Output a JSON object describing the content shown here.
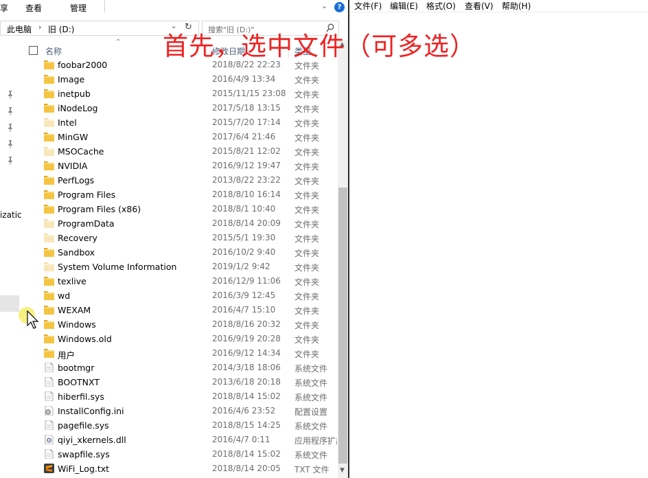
{
  "explorer": {
    "ribbon": {
      "tabs": [
        "享",
        "查看",
        "管理"
      ]
    },
    "address": {
      "crumbs": [
        "此电脑",
        "旧 (D:)"
      ]
    },
    "search": {
      "placeholder": "搜索\"旧 (D:)\""
    },
    "nav": {
      "partial_text": "izatic"
    },
    "columns": {
      "name": "名称",
      "date": "修改日期",
      "type": "类型"
    },
    "files": [
      {
        "name": "foobar2000",
        "date": "2018/8/22 22:23",
        "type": "文件夹",
        "icon": "folder-icon"
      },
      {
        "name": "Image",
        "date": "2016/4/9 13:34",
        "type": "文件夹",
        "icon": "folder-icon"
      },
      {
        "name": "inetpub",
        "date": "2015/11/15 23:08",
        "type": "文件夹",
        "icon": "folder-icon"
      },
      {
        "name": "iNodeLog",
        "date": "2017/5/18 13:15",
        "type": "文件夹",
        "icon": "folder-icon"
      },
      {
        "name": "Intel",
        "date": "2015/7/20 17:14",
        "type": "文件夹",
        "icon": "folder-hidden-icon"
      },
      {
        "name": "MinGW",
        "date": "2017/6/4 21:46",
        "type": "文件夹",
        "icon": "folder-icon"
      },
      {
        "name": "MSOCache",
        "date": "2015/8/21 12:02",
        "type": "文件夹",
        "icon": "folder-hidden-icon"
      },
      {
        "name": "NVIDIA",
        "date": "2016/9/12 19:47",
        "type": "文件夹",
        "icon": "folder-icon"
      },
      {
        "name": "PerfLogs",
        "date": "2013/8/22 23:22",
        "type": "文件夹",
        "icon": "folder-icon"
      },
      {
        "name": "Program Files",
        "date": "2018/8/10 16:14",
        "type": "文件夹",
        "icon": "folder-icon"
      },
      {
        "name": "Program Files (x86)",
        "date": "2018/8/1 10:40",
        "type": "文件夹",
        "icon": "folder-icon"
      },
      {
        "name": "ProgramData",
        "date": "2018/8/14 20:09",
        "type": "文件夹",
        "icon": "folder-hidden-icon"
      },
      {
        "name": "Recovery",
        "date": "2015/5/1 19:30",
        "type": "文件夹",
        "icon": "folder-hidden-icon"
      },
      {
        "name": "Sandbox",
        "date": "2016/10/2 9:40",
        "type": "文件夹",
        "icon": "folder-icon"
      },
      {
        "name": "System Volume Information",
        "date": "2019/1/2 9:42",
        "type": "文件夹",
        "icon": "folder-hidden-icon"
      },
      {
        "name": "texlive",
        "date": "2016/12/9 11:06",
        "type": "文件夹",
        "icon": "folder-icon"
      },
      {
        "name": "wd",
        "date": "2016/3/9 12:45",
        "type": "文件夹",
        "icon": "folder-icon"
      },
      {
        "name": "WEXAM",
        "date": "2016/4/7 15:10",
        "type": "文件夹",
        "icon": "folder-icon"
      },
      {
        "name": "Windows",
        "date": "2018/8/16 20:32",
        "type": "文件夹",
        "icon": "folder-icon"
      },
      {
        "name": "Windows.old",
        "date": "2016/9/19 20:28",
        "type": "文件夹",
        "icon": "folder-icon"
      },
      {
        "name": "用户",
        "date": "2016/9/12 14:34",
        "type": "文件夹",
        "icon": "folder-icon"
      },
      {
        "name": "bootmgr",
        "date": "2014/3/18 18:06",
        "type": "系统文件",
        "icon": "file-icon"
      },
      {
        "name": "BOOTNXT",
        "date": "2013/6/18 20:18",
        "type": "系统文件",
        "icon": "file-icon"
      },
      {
        "name": "hiberfil.sys",
        "date": "2018/8/14 15:02",
        "type": "系统文件",
        "icon": "file-icon"
      },
      {
        "name": "InstallConfig.ini",
        "date": "2016/4/6 23:52",
        "type": "配置设置",
        "icon": "settings-file-icon"
      },
      {
        "name": "pagefile.sys",
        "date": "2018/8/15 14:25",
        "type": "系统文件",
        "icon": "file-icon"
      },
      {
        "name": "qiyi_xkernels.dll",
        "date": "2016/4/7 0:11",
        "type": "应用程序扩展",
        "icon": "dll-file-icon"
      },
      {
        "name": "swapfile.sys",
        "date": "2018/8/14 15:02",
        "type": "系统文件",
        "icon": "file-icon"
      },
      {
        "name": "WiFi_Log.txt",
        "date": "2018/8/14 20:05",
        "type": "TXT 文件",
        "icon": "sublime-text-icon"
      }
    ],
    "help_label": "?"
  },
  "notepad": {
    "menu": [
      "文件(F)",
      "编辑(E)",
      "格式(O)",
      "查看(V)",
      "帮助(H)"
    ],
    "content": ""
  },
  "caption": "首先，选中文件（可多选）",
  "colors": {
    "folder": "#f4c542",
    "caption": "#ee2222",
    "help": "#1a6ed8"
  }
}
